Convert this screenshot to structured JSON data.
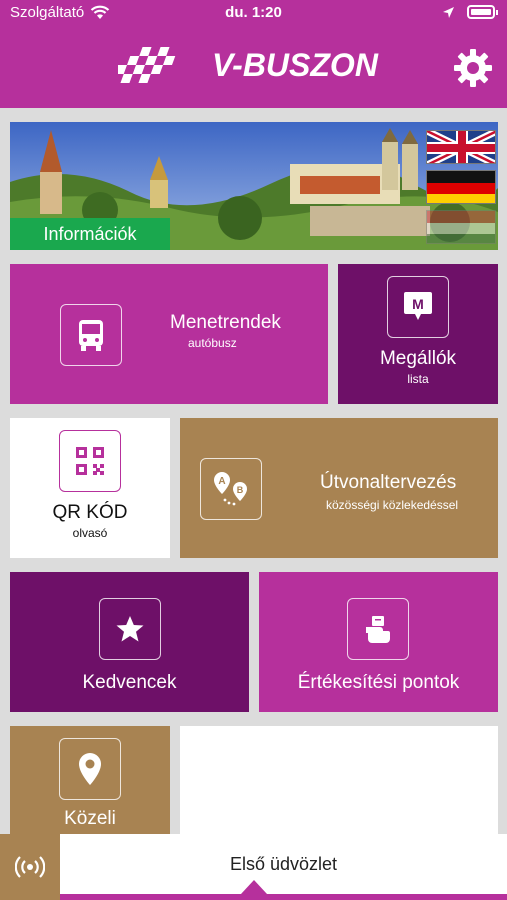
{
  "status_bar": {
    "carrier": "Szolgáltató",
    "time": "du. 1:20"
  },
  "header": {
    "app_name": "V-BUSZON"
  },
  "banner": {
    "label": "Információk"
  },
  "tiles": {
    "menetrend": {
      "title": "Menetrendek",
      "subtitle": "autóbusz"
    },
    "megallok": {
      "title": "Megállók",
      "subtitle": "lista"
    },
    "qr": {
      "title": "QR KÓD",
      "subtitle": "olvasó"
    },
    "utvonal": {
      "title": "Útvonaltervezés",
      "subtitle": "közösségi közlekedéssel"
    },
    "kedvencek": {
      "title": "Kedvencek"
    },
    "ertekesitesi": {
      "title": "Értékesítési pontok"
    },
    "kozeli": {
      "title": "Közeli"
    }
  },
  "bottom_bar": {
    "message": "Első üdvözlet"
  },
  "colors": {
    "magenta": "#b6309c",
    "dark_purple": "#6e1068",
    "tan": "#a88352",
    "green": "#1aa84e"
  }
}
